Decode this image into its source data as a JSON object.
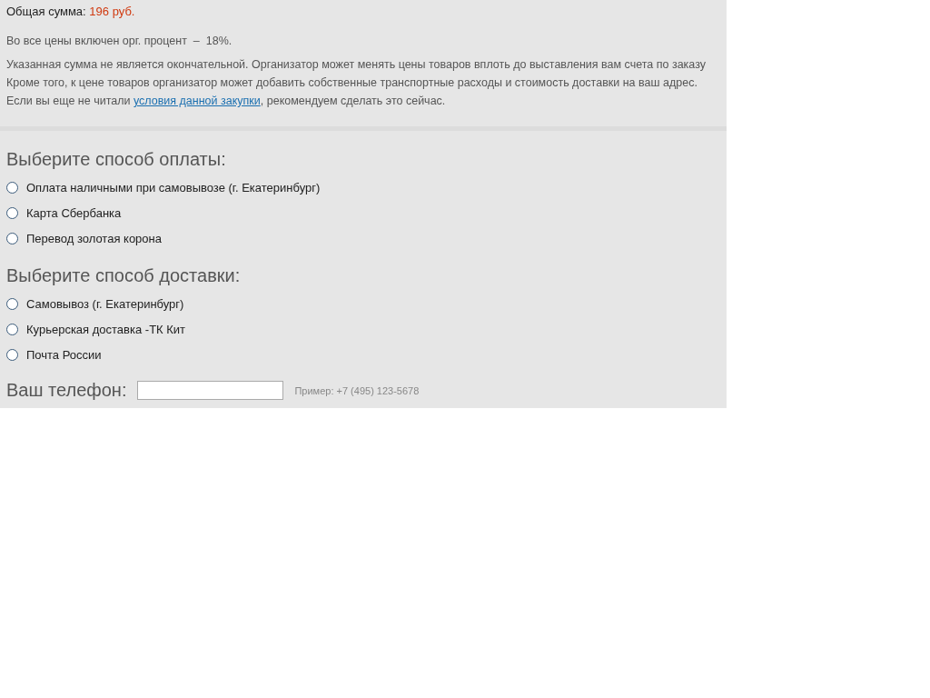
{
  "summary": {
    "total_label": "Общая сумма:",
    "total_value": "196 руб.",
    "fee_note": "Во все цены включен орг. процент  –  18%.",
    "notes": [
      "Указанная сумма не является окончательной. Организатор может менять цены товаров вплоть до выставления вам счета по заказу",
      "Кроме того, к цене товаров организатор может добавить собственные транспортные расходы и стоимость доставки на ваш адрес."
    ],
    "terms_before": "Если вы еще не читали ",
    "terms_link": "условия данной закупки",
    "terms_after": ", рекомендуем сделать это сейчас."
  },
  "payment": {
    "heading": "Выберите способ оплаты:",
    "options": [
      {
        "label": "Оплата наличными при самовывозе (г. Екатеринбург)",
        "selected": false
      },
      {
        "label": "Карта Сбербанка",
        "selected": false
      },
      {
        "label": "Перевод золотая корона",
        "selected": false
      }
    ]
  },
  "delivery": {
    "heading": "Выберите способ доставки:",
    "options": [
      {
        "label": "Самовывоз (г. Екатеринбург)",
        "selected": false
      },
      {
        "label": "Курьерская доставка -ТК Кит",
        "selected": false
      },
      {
        "label": "Почта России",
        "selected": false
      }
    ]
  },
  "phone": {
    "label": "Ваш телефон:",
    "hint": "Пример: +7 (495) 123-5678"
  }
}
